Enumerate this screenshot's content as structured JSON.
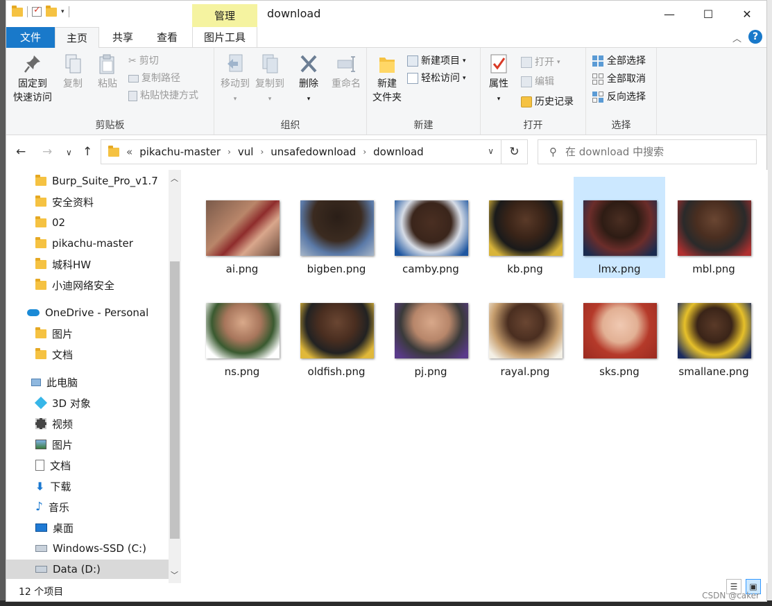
{
  "window": {
    "title": "download",
    "minimize_glyph": "—",
    "maximize_glyph": "☐",
    "close_glyph": "✕"
  },
  "ribbon_tabs": {
    "file": "文件",
    "home": "主页",
    "share": "共享",
    "view": "查看",
    "manage": "管理",
    "picture_tools": "图片工具"
  },
  "clipboard": {
    "pin_l1": "固定到",
    "pin_l2": "快速访问",
    "copy": "复制",
    "paste": "粘贴",
    "cut": "剪切",
    "copy_path": "复制路径",
    "paste_shortcut": "粘贴快捷方式",
    "label": "剪贴板"
  },
  "organize": {
    "move_to": "移动到",
    "copy_to": "复制到",
    "delete": "删除",
    "rename": "重命名",
    "label": "组织"
  },
  "new": {
    "new_folder_l1": "新建",
    "new_folder_l2": "文件夹",
    "new_item": "新建项目",
    "easy_access": "轻松访问",
    "label": "新建"
  },
  "open": {
    "properties": "属性",
    "open": "打开",
    "edit": "编辑",
    "history": "历史记录",
    "label": "打开"
  },
  "select": {
    "select_all": "全部选择",
    "select_none": "全部取消",
    "invert": "反向选择",
    "label": "选择"
  },
  "address": {
    "overflow": "«",
    "crumbs": [
      "pikachu-master",
      "vul",
      "unsafedownload",
      "download"
    ]
  },
  "search": {
    "placeholder": "在 download 中搜索"
  },
  "nav": {
    "items": [
      "Burp_Suite_Pro_v1.7",
      "安全资料",
      "02",
      "pikachu-master",
      "城科HW",
      "小迪网络安全",
      "OneDrive - Personal",
      "图片",
      "文档",
      "此电脑",
      "3D 对象",
      "视频",
      "图片",
      "文档",
      "下载",
      "音乐",
      "桌面",
      "Windows-SSD (C:)",
      "Data (D:)"
    ]
  },
  "files": [
    "ai.png",
    "bigben.png",
    "camby.png",
    "kb.png",
    "lmx.png",
    "mbl.png",
    "ns.png",
    "oldfish.png",
    "pj.png",
    "rayal.png",
    "sks.png",
    "smallane.png"
  ],
  "status": {
    "count": "12 个项目"
  },
  "watermark": "CSDN @caker",
  "colors": {
    "accent": "#1979ca",
    "selection": "#cce8ff",
    "manage_tab": "#f5f3a0"
  }
}
